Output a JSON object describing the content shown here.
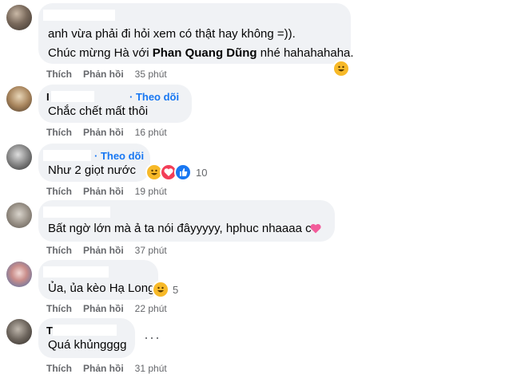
{
  "comments": [
    {
      "lines": [
        "anh vừa phải đi hỏi xem có thật hay không =))."
      ],
      "line2_prefix": "Chúc mừng Hà với ",
      "line2_bold": "Phan Quang Dũng",
      "line2_suffix": " nhé hahahahaha.",
      "like": "Thích",
      "reply": "Phản hồi",
      "time": "35 phút"
    },
    {
      "name_initial": "I",
      "follow": "· Theo dõi",
      "text": "Chắc chết mất thôi",
      "like": "Thích",
      "reply": "Phản hồi",
      "time": "16 phút"
    },
    {
      "follow": "· Theo dõi",
      "text": "Như 2 giọt nước",
      "reaction_count": "10",
      "like": "Thích",
      "reply": "Phản hồi",
      "time": "19 phút"
    },
    {
      "text": "Bất ngờ lớn mà ả ta nói đâyyyyy, hphuc nhaaaa c",
      "like": "Thích",
      "reply": "Phản hồi",
      "time": "37 phút"
    },
    {
      "text": "Ủa, ủa kèo Hạ Long",
      "reaction_count": "5",
      "like": "Thích",
      "reply": "Phản hồi",
      "time": "22 phút"
    },
    {
      "name_initial": "T",
      "text": "Quá khủngggg",
      "more": "···",
      "like": "Thích",
      "reply": "Phản hồi",
      "time": "31 phút"
    }
  ],
  "colors": {
    "bubble": "#f0f2f5",
    "link": "#1877f2",
    "meta": "#65676b"
  }
}
